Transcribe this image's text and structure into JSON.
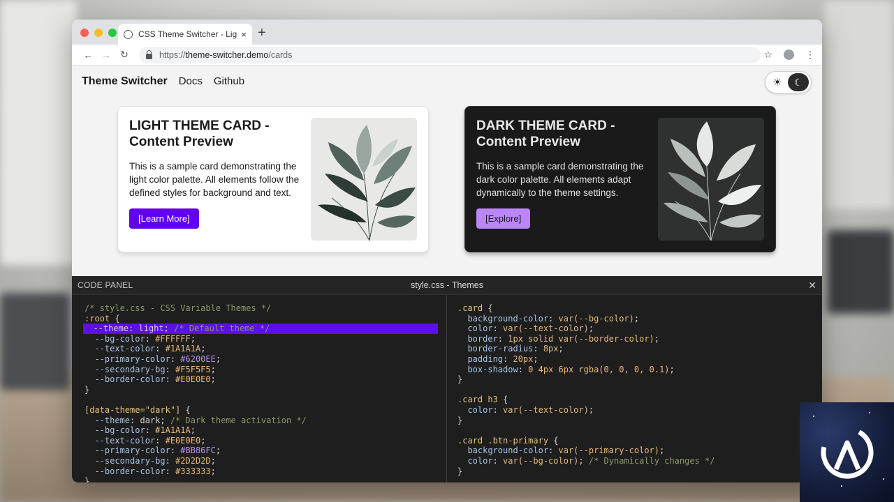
{
  "browser": {
    "tab_title": "CSS Theme Switcher - Light vs Dark",
    "tab_close": "×",
    "new_tab": "+",
    "url_scheme": "https://",
    "url_host": "theme-switcher.demo",
    "url_path": "/cards"
  },
  "nav": {
    "brand": "Theme Switcher",
    "links": [
      "Docs",
      "Github"
    ]
  },
  "theme_toggle": {
    "sun": "☀",
    "moon": "☾"
  },
  "cards": {
    "light": {
      "title": "LIGHT THEME CARD - Content Preview",
      "body": "This is a sample card demonstrating the light color palette. All elements follow the defined styles for background and text.",
      "button": "[Learn More]"
    },
    "dark": {
      "title": "DARK THEME CARD - Content Preview",
      "body": "This is a sample card demonstrating the dark color palette. All elements adapt dynamically to the theme settings.",
      "button": "[Explore]"
    }
  },
  "panel": {
    "label": "CODE PANEL",
    "file": "style.css - Themes",
    "close": "✕",
    "left_lines": [
      [
        [
          "c-com",
          "/* style.css - CSS Variable Themes */"
        ]
      ],
      [
        [
          "c-sel",
          ":root"
        ],
        [
          "",
          " {"
        ]
      ],
      [
        [
          "",
          "  --theme: light; "
        ],
        [
          "c-com",
          "/* Default theme */"
        ]
      ],
      [
        [
          "c-prop",
          "  --bg-color"
        ],
        [
          "",
          ": "
        ],
        [
          "c-val",
          "#FFFFFF"
        ],
        [
          "",
          ";"
        ]
      ],
      [
        [
          "c-prop",
          "  --text-color"
        ],
        [
          "",
          ": "
        ],
        [
          "c-val",
          "#1A1A1A"
        ],
        [
          "",
          ";"
        ]
      ],
      [
        [
          "c-prop",
          "  --primary-color"
        ],
        [
          "",
          ": "
        ],
        [
          "c-purple",
          "#6200EE"
        ],
        [
          "",
          ";"
        ]
      ],
      [
        [
          "c-prop",
          "  --secondary-bg"
        ],
        [
          "",
          ": "
        ],
        [
          "c-val",
          "#F5F5F5"
        ],
        [
          "",
          ";"
        ]
      ],
      [
        [
          "c-prop",
          "  --border-color"
        ],
        [
          "",
          ": "
        ],
        [
          "c-val",
          "#E0E0E0"
        ],
        [
          "",
          ";"
        ]
      ],
      [
        [
          "",
          "}"
        ]
      ],
      [
        [
          "",
          ""
        ]
      ],
      [
        [
          "c-sel",
          "[data-theme=\"dark\"]"
        ],
        [
          "",
          " {"
        ]
      ],
      [
        [
          "c-prop",
          "  --theme"
        ],
        [
          "",
          ": dark; "
        ],
        [
          "c-com",
          "/* Dark theme activation */"
        ]
      ],
      [
        [
          "c-prop",
          "  --bg-color"
        ],
        [
          "",
          ": "
        ],
        [
          "c-val",
          "#1A1A1A"
        ],
        [
          "",
          ";"
        ]
      ],
      [
        [
          "c-prop",
          "  --text-color"
        ],
        [
          "",
          ": "
        ],
        [
          "c-val",
          "#E0E0E0"
        ],
        [
          "",
          ";"
        ]
      ],
      [
        [
          "c-prop",
          "  --primary-color"
        ],
        [
          "",
          ": "
        ],
        [
          "c-purple",
          "#BB86FC"
        ],
        [
          "",
          ";"
        ]
      ],
      [
        [
          "c-prop",
          "  --secondary-bg"
        ],
        [
          "",
          ": "
        ],
        [
          "c-val",
          "#2D2D2D"
        ],
        [
          "",
          ";"
        ]
      ],
      [
        [
          "c-prop",
          "  --border-color"
        ],
        [
          "",
          ": "
        ],
        [
          "c-val",
          "#333333"
        ],
        [
          "",
          ";"
        ]
      ],
      [
        [
          "",
          "}"
        ]
      ]
    ],
    "right_lines": [
      [
        [
          "c-sel",
          ".card"
        ],
        [
          "",
          " {"
        ]
      ],
      [
        [
          "c-prop",
          "  background-color"
        ],
        [
          "",
          ": "
        ],
        [
          "c-val",
          "var(--bg-color)"
        ],
        [
          "",
          ";"
        ]
      ],
      [
        [
          "c-prop",
          "  color"
        ],
        [
          "",
          ": "
        ],
        [
          "c-val",
          "var(--text-color)"
        ],
        [
          "",
          ";"
        ]
      ],
      [
        [
          "c-prop",
          "  border"
        ],
        [
          "",
          ": "
        ],
        [
          "c-val",
          "1px solid var(--border-color)"
        ],
        [
          "",
          ";"
        ]
      ],
      [
        [
          "c-prop",
          "  border-radius"
        ],
        [
          "",
          ": "
        ],
        [
          "c-val",
          "8px"
        ],
        [
          "",
          ";"
        ]
      ],
      [
        [
          "c-prop",
          "  padding"
        ],
        [
          "",
          ": "
        ],
        [
          "c-val",
          "20px"
        ],
        [
          "",
          ";"
        ]
      ],
      [
        [
          "c-prop",
          "  box-shadow"
        ],
        [
          "",
          ": "
        ],
        [
          "c-val",
          "0 4px 6px rgba(0, 0, 0, 0.1)"
        ],
        [
          "",
          ";"
        ]
      ],
      [
        [
          "",
          "}"
        ]
      ],
      [
        [
          "",
          ""
        ]
      ],
      [
        [
          "c-sel",
          ".card h3"
        ],
        [
          "",
          " {"
        ]
      ],
      [
        [
          "c-prop",
          "  color"
        ],
        [
          "",
          ": "
        ],
        [
          "c-val",
          "var(--text-color)"
        ],
        [
          "",
          ";"
        ]
      ],
      [
        [
          "",
          "}"
        ]
      ],
      [
        [
          "",
          ""
        ]
      ],
      [
        [
          "c-sel",
          ".card .btn-primary"
        ],
        [
          "",
          " {"
        ]
      ],
      [
        [
          "c-prop",
          "  background-color"
        ],
        [
          "",
          ": "
        ],
        [
          "c-val",
          "var(--primary-color)"
        ],
        [
          "",
          ";"
        ]
      ],
      [
        [
          "c-prop",
          "  color"
        ],
        [
          "",
          ": "
        ],
        [
          "c-val",
          "var(--bg-color)"
        ],
        [
          "",
          "; "
        ],
        [
          "c-com",
          "/* Dynamically changes */"
        ]
      ],
      [
        [
          "",
          "}"
        ]
      ]
    ]
  },
  "colors": {
    "light_bg": "#FFFFFF",
    "light_text": "#1A1A1A",
    "light_primary": "#6200EE",
    "dark_bg": "#1A1A1A",
    "dark_text": "#E0E0E0",
    "dark_primary": "#BB86FC"
  }
}
